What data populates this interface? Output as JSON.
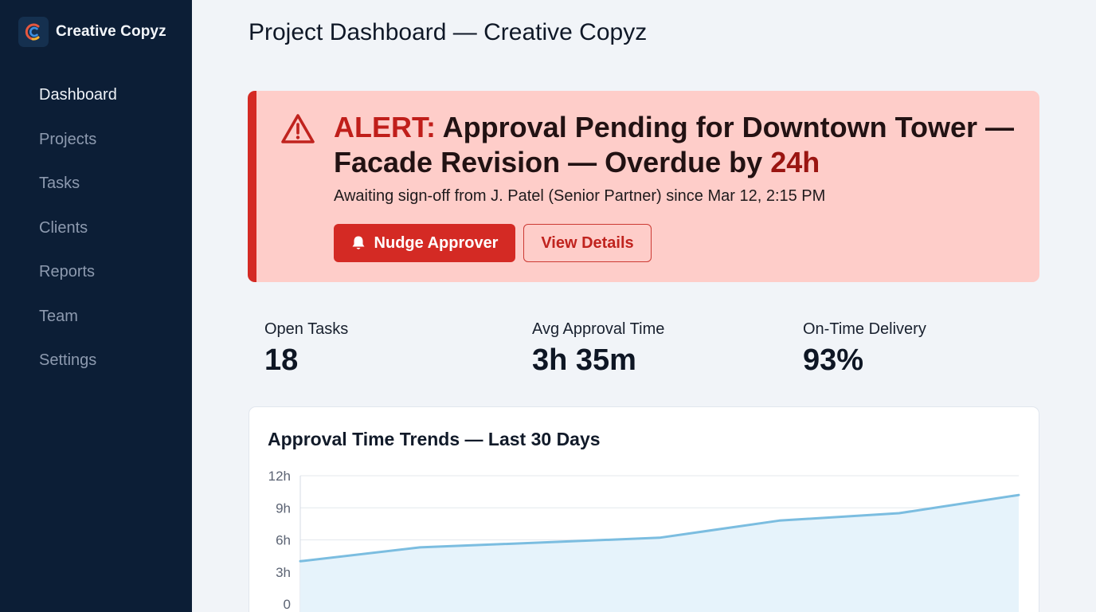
{
  "brand": {
    "name": "Creative Copyz",
    "logo_icon": "creative-copyz-logo"
  },
  "sidebar": {
    "items": [
      {
        "label": "Dashboard",
        "active": true
      },
      {
        "label": "Projects",
        "active": false
      },
      {
        "label": "Tasks",
        "active": false
      },
      {
        "label": "Clients",
        "active": false
      },
      {
        "label": "Reports",
        "active": false
      },
      {
        "label": "Team",
        "active": false
      },
      {
        "label": "Settings",
        "active": false
      }
    ]
  },
  "page": {
    "title": "Project Dashboard — Creative Copyz"
  },
  "alert": {
    "icon": "warning-triangle-icon",
    "prefix": "ALERT:",
    "headline": " Approval Pending for Downtown Tower — Facade Revision — Overdue by ",
    "overdue": "24h",
    "subtext": "Awaiting sign-off from J. Patel (Senior Partner) since Mar 12, 2:15 PM",
    "primary_button": {
      "label": "Nudge Approver",
      "icon": "bell-icon"
    },
    "secondary_button": {
      "label": "View Details"
    }
  },
  "stats": [
    {
      "label": "Open Tasks",
      "value": "18"
    },
    {
      "label": "Avg Approval Time",
      "value": "3h 35m"
    },
    {
      "label": "On-Time Delivery",
      "value": "93%"
    }
  ],
  "colors": {
    "sidebar_bg": "#0c1e36",
    "alert_accent": "#d42a24",
    "alert_bg": "#fecdc9",
    "chart_line": "#7bbde0",
    "chart_fill": "#e6f3fb"
  },
  "chart_data": {
    "type": "area",
    "title": "Approval Time Trends — Last 30 Days",
    "xlabel": "",
    "ylabel": "",
    "y_tick_labels": [
      "0",
      "3h",
      "6h",
      "9h",
      "12h"
    ],
    "y_tick_values": [
      0,
      3,
      6,
      9,
      12
    ],
    "ylim": [
      0,
      12
    ],
    "x": [
      0,
      5,
      15,
      20,
      25,
      30
    ],
    "xlim": [
      0,
      30
    ],
    "series": [
      {
        "values": [
          4.0,
          5.3,
          6.2,
          7.8,
          8.5,
          10.2
        ]
      }
    ],
    "grid": true,
    "legend": "none"
  }
}
